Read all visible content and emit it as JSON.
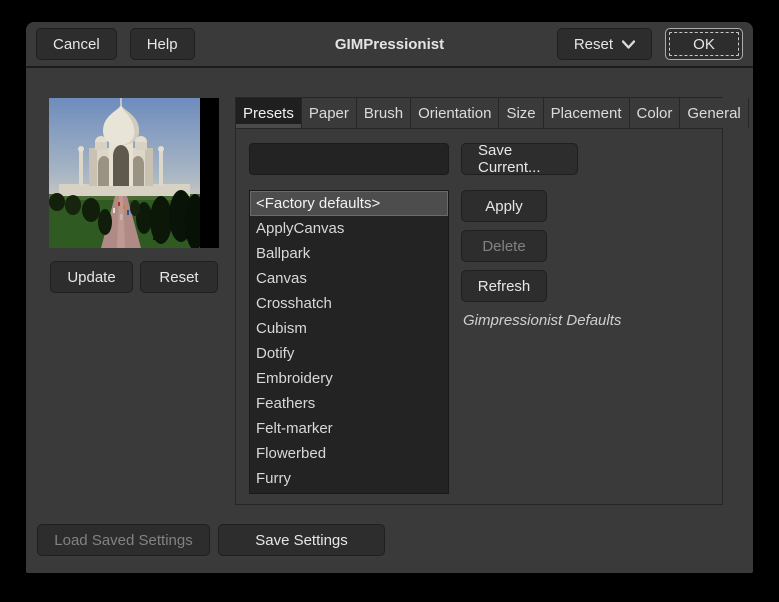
{
  "window": {
    "title": "GIMPressionist"
  },
  "header": {
    "cancel_label": "Cancel",
    "help_label": "Help",
    "reset_label": "Reset",
    "ok_label": "OK"
  },
  "preview": {
    "image_alt": "taj-mahal-preview",
    "update_label": "Update",
    "reset_label": "Reset"
  },
  "tabs": [
    {
      "label": "Presets",
      "active": true
    },
    {
      "label": "Paper",
      "active": false
    },
    {
      "label": "Brush",
      "active": false
    },
    {
      "label": "Orientation",
      "active": false
    },
    {
      "label": "Size",
      "active": false
    },
    {
      "label": "Placement",
      "active": false
    },
    {
      "label": "Color",
      "active": false
    },
    {
      "label": "General",
      "active": false
    }
  ],
  "presets": {
    "entry_value": "",
    "save_current_label": "Save Current...",
    "items": [
      "<Factory defaults>",
      "ApplyCanvas",
      "Ballpark",
      "Canvas",
      "Crosshatch",
      "Cubism",
      "Dotify",
      "Embroidery",
      "Feathers",
      "Felt-marker",
      "Flowerbed",
      "Furry"
    ],
    "selected_index": 0,
    "apply_label": "Apply",
    "delete_label": "Delete",
    "refresh_label": "Refresh",
    "description": "Gimpressionist Defaults"
  },
  "footer": {
    "load_label": "Load Saved Settings",
    "save_label": "Save Settings"
  },
  "colors": {
    "dialog_bg": "#3a3a3a",
    "button_bg": "#2d2d2d",
    "list_bg": "#232323",
    "selected_row": "#4d4d4d",
    "text": "#e6e6e6",
    "disabled_text": "#828282",
    "active_tab_bg": "#1f1f1f"
  }
}
